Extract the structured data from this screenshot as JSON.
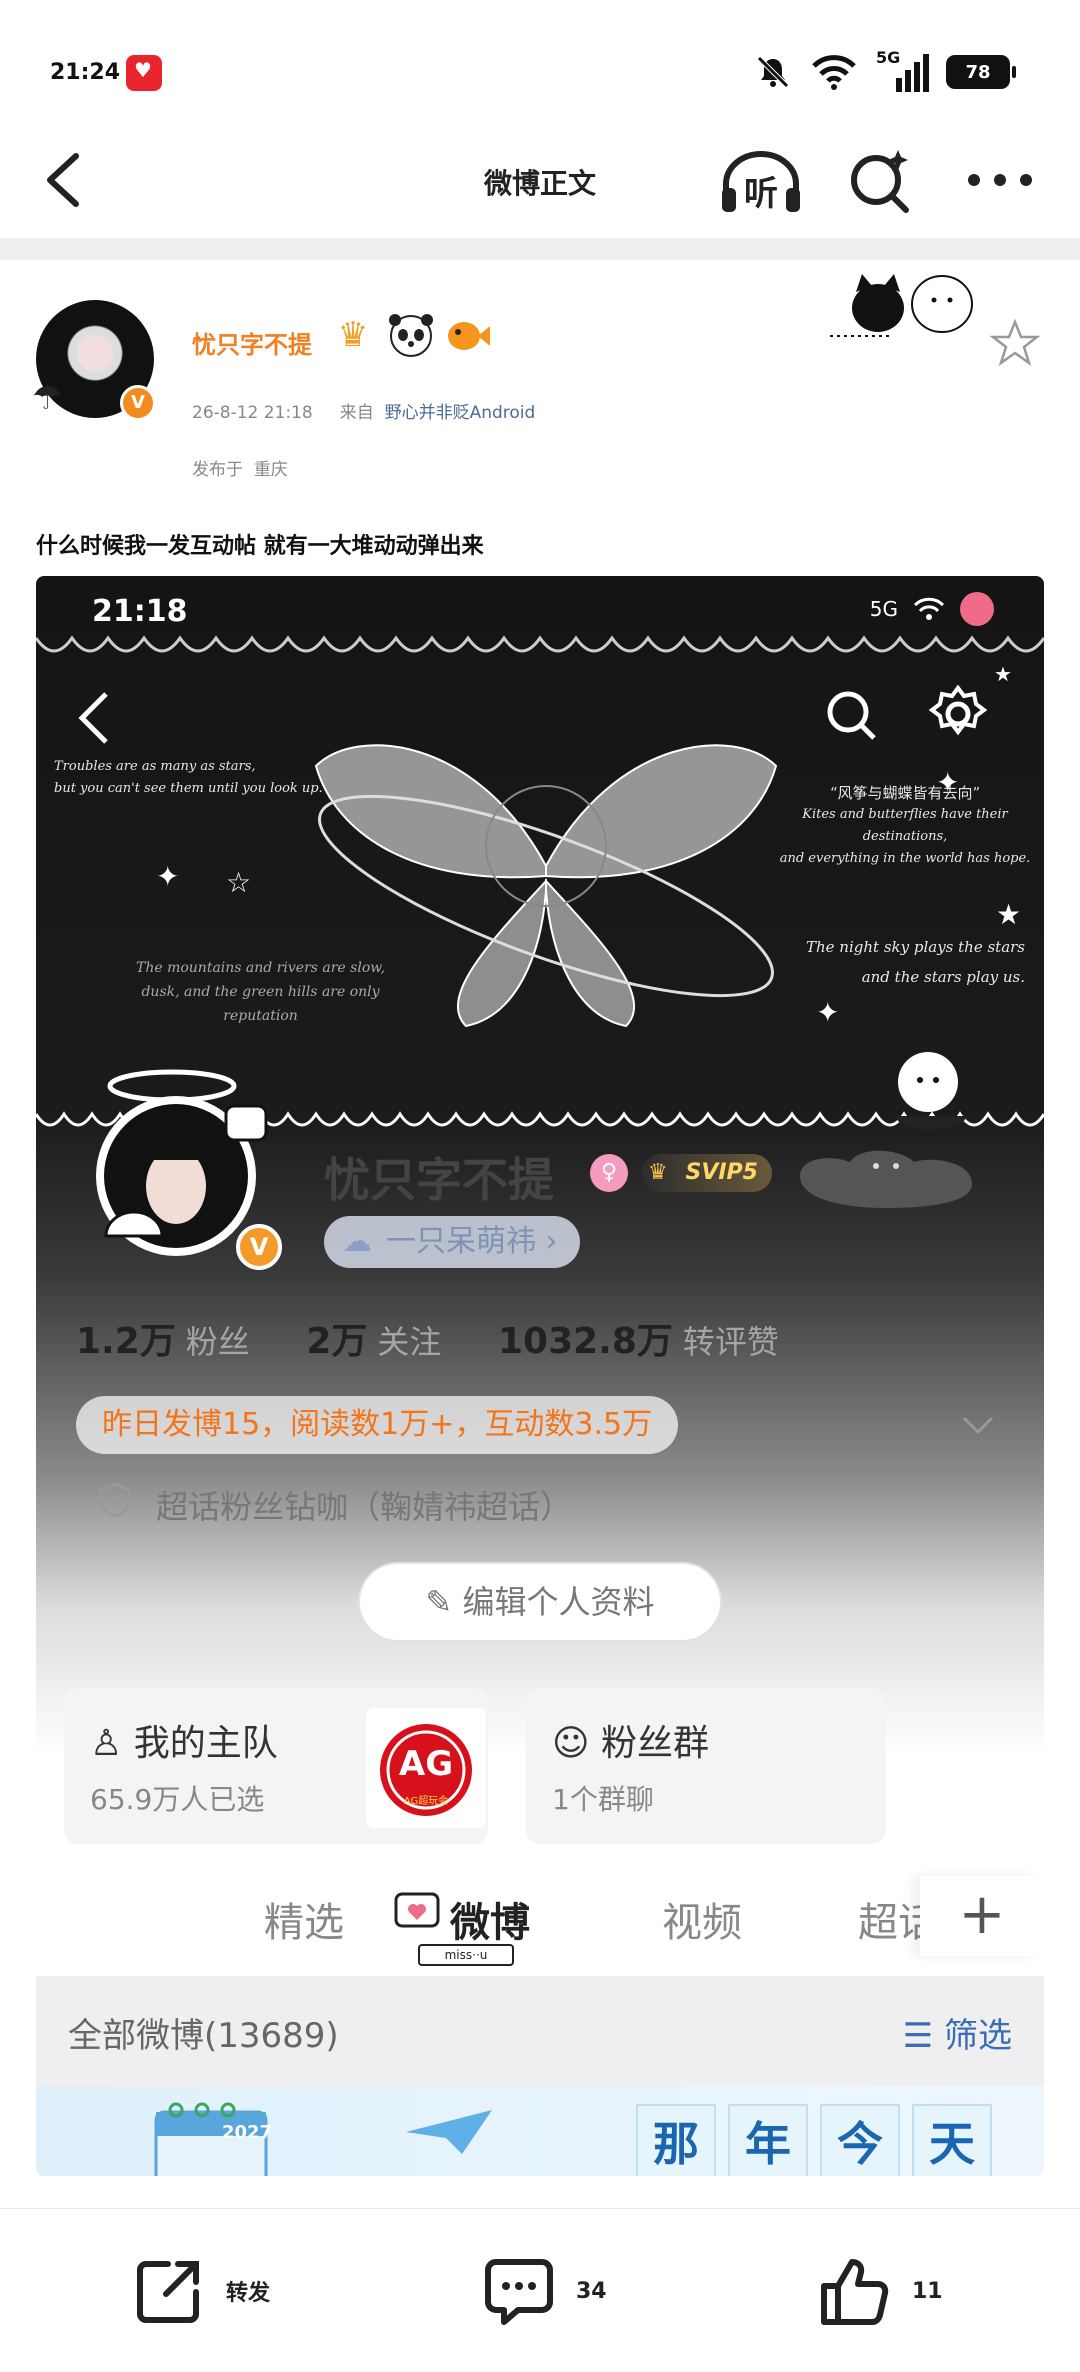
{
  "status_bar": {
    "time": "21:24",
    "network": "5G",
    "battery": "78"
  },
  "header": {
    "title": "微博正文",
    "listen_label": "听"
  },
  "post": {
    "username": "忧只字不提",
    "timestamp": "26-8-12 21:18",
    "source_prefix": "来自",
    "source": "野心并非贬Android",
    "location_prefix": "发布于",
    "location": "重庆",
    "verified_badge": "V",
    "text": "什么时候我一发互动帖 就有一大堆动动弹出来"
  },
  "screenshot": {
    "status_time": "21:18",
    "status_network": "5G",
    "quotes": {
      "left_top": [
        "Troubles are as many as stars,",
        "but you can't see them until you look up."
      ],
      "right_top_cn": "“风筝与蝴蝶皆有去向”",
      "right_top_en": [
        "Kites and butterflies have their destinations,",
        "and everything in the world has hope."
      ],
      "right_mid": [
        "The night sky plays the stars",
        "and the stars play us."
      ],
      "left_mid": [
        "The mountains and rivers are slow,",
        "dusk, and the green hills are only",
        "reputation"
      ]
    },
    "profile_name": "忧只字不提",
    "svip": "SVIP5",
    "nickname_tag": "一只呆萌祎",
    "stats": {
      "fans_value": "1.2万",
      "fans_label": "粉丝",
      "follow_value": "2万",
      "follow_label": "关注",
      "likes_value": "1032.8万",
      "likes_label": "转评赞"
    },
    "yesterday": "昨日发博15，阅读数1万+，互动数3.5万",
    "super_topic": "超话粉丝钻咖（鞠婧祎超话）",
    "edit_profile": "编辑个人资料",
    "card_team": {
      "title": "我的主队",
      "sub": "65.9万人已选",
      "logo_text": "AG",
      "logo_sub": "AG超玩会"
    },
    "card_fans": {
      "title": "粉丝群",
      "sub": "1个群聊"
    },
    "tabs": [
      "精选",
      "微博",
      "视频",
      "超话"
    ],
    "miss_tag": "miss··u",
    "all_weibo": "全部微博(13689)",
    "filter": "筛选",
    "banner": {
      "year": "2027",
      "chars": [
        "那",
        "年",
        "今",
        "天"
      ]
    }
  },
  "bottom_bar": {
    "repost": "转发",
    "comment_count": "34",
    "like_count": "11"
  },
  "colors": {
    "username": "#f08020",
    "source_link": "#4c6a9a",
    "filter_blue": "#3a6db5",
    "yesterday_orange": "#f2751b"
  }
}
